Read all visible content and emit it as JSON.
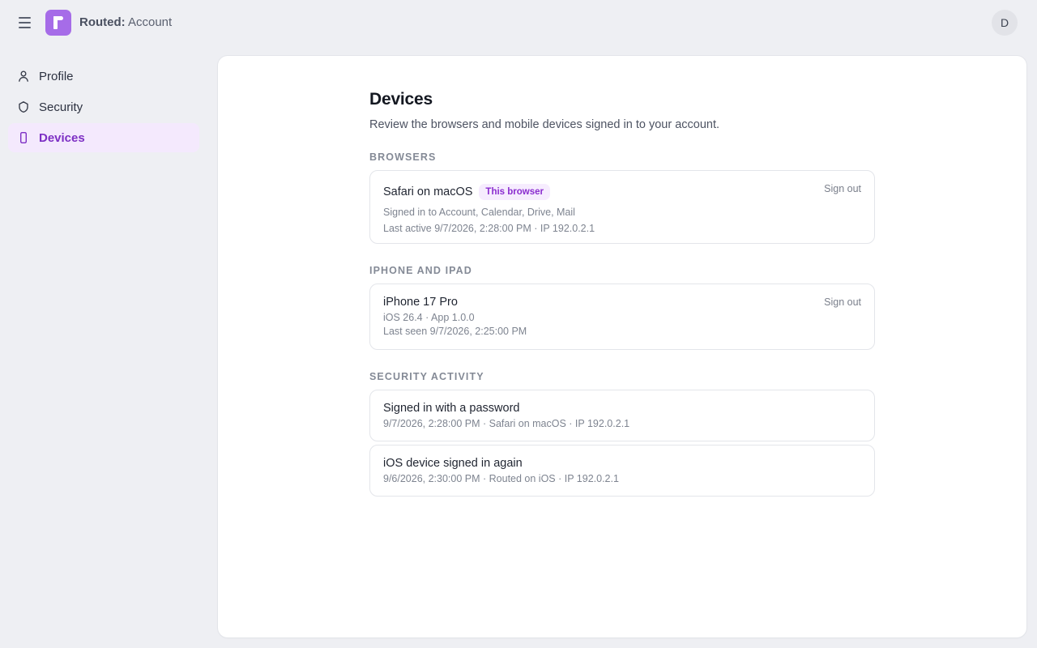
{
  "header": {
    "brand_name": "Routed:",
    "brand_suffix": " Account",
    "avatar_initial": "D"
  },
  "sidebar": {
    "items": [
      {
        "label": "Profile",
        "icon": "user-icon"
      },
      {
        "label": "Security",
        "icon": "shield-icon"
      },
      {
        "label": "Devices",
        "icon": "phone-icon",
        "active": true
      }
    ]
  },
  "main": {
    "title": "Devices",
    "description": "Review the browsers and mobile devices signed in to your account.",
    "browsers": {
      "label": "Browsers",
      "items": [
        {
          "name": "Safari on macOS",
          "badge": "This browser",
          "services": "Signed in to Account, Calendar, Drive, Mail",
          "last_active": "Last active 9/7/2026, 2:28:00 PM · IP 192.0.2.1",
          "action": "Sign out"
        }
      ]
    },
    "mobile": {
      "label": "iPhone and iPad",
      "items": [
        {
          "name": "iPhone 17 Pro",
          "version": "iOS 26.4 · App 1.0.0",
          "last_seen": "Last seen 9/7/2026, 2:25:00 PM",
          "action": "Sign out"
        }
      ]
    },
    "activity": {
      "label": "Security activity",
      "items": [
        {
          "title": "Signed in with a password",
          "detail": "9/7/2026, 2:28:00 PM · Safari on macOS · IP 192.0.2.1"
        },
        {
          "title": "iOS device signed in again",
          "detail": "9/6/2026, 2:30:00 PM · Routed on iOS · IP 192.0.2.1"
        }
      ]
    }
  },
  "colors": {
    "accent": "#a66ce8",
    "active_nav_bg": "#f4e9fd",
    "active_nav_text": "#7d2fc4",
    "page_bg": "#eeeff3"
  }
}
